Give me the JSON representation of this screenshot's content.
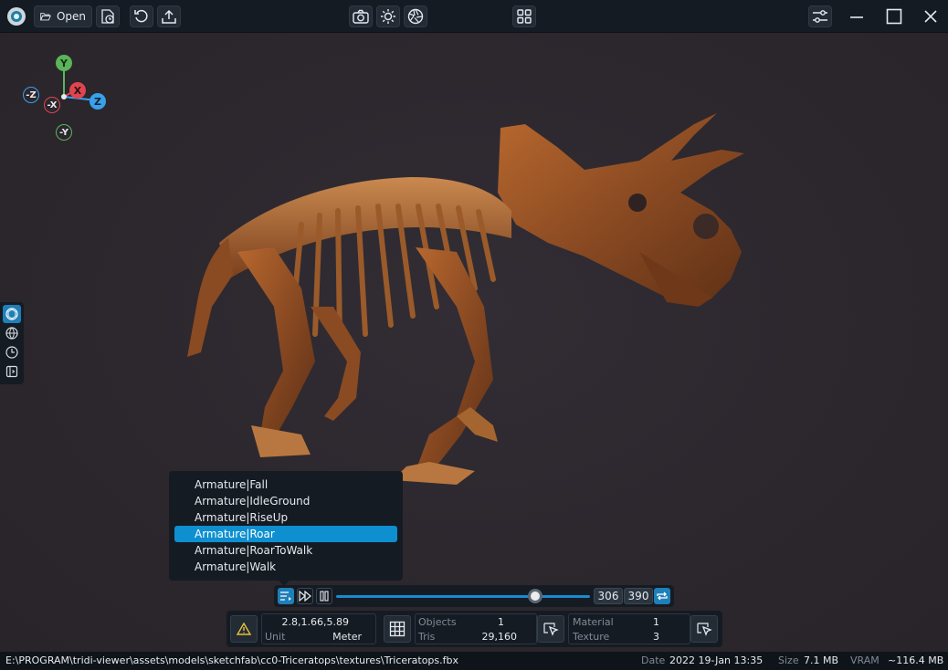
{
  "toolbar": {
    "open_label": "Open"
  },
  "gizmo": {
    "y": "Y",
    "neg_y": "-Y",
    "x": "X",
    "neg_x": "-X",
    "z": "Z",
    "neg_z": "-Z"
  },
  "animations": [
    {
      "label": "Armature|Fall",
      "selected": false
    },
    {
      "label": "Armature|IdleGround",
      "selected": false
    },
    {
      "label": "Armature|RiseUp",
      "selected": false
    },
    {
      "label": "Armature|Roar",
      "selected": true
    },
    {
      "label": "Armature|RoarToWalk",
      "selected": false
    },
    {
      "label": "Armature|Walk",
      "selected": false
    }
  ],
  "timeline": {
    "current_frame": "306",
    "total_frames": "390",
    "progress": 0.785
  },
  "stats": {
    "dimensions": "2.8,1.66,5.89",
    "unit_label": "Unit",
    "unit_value": "Meter",
    "objects_label": "Objects",
    "objects_value": "1",
    "tris_label": "Tris",
    "tris_value": "29,160",
    "material_label": "Material",
    "material_value": "1",
    "texture_label": "Texture",
    "texture_value": "3"
  },
  "status": {
    "path": "E:\\PROGRAM\\tridi-viewer\\assets\\models\\sketchfab\\cc0-Triceratops\\textures\\Triceratops.fbx",
    "date_label": "Date",
    "date_value": "2022 19-Jan 13:35",
    "size_label": "Size",
    "size_value": "7.1 MB",
    "vram_label": "VRAM",
    "vram_value": "~116.4 MB"
  },
  "colors": {
    "accent": "#0e8fd0",
    "axis_x": "#e0454f",
    "axis_y": "#5ab55a",
    "axis_z": "#3aa0ea"
  }
}
